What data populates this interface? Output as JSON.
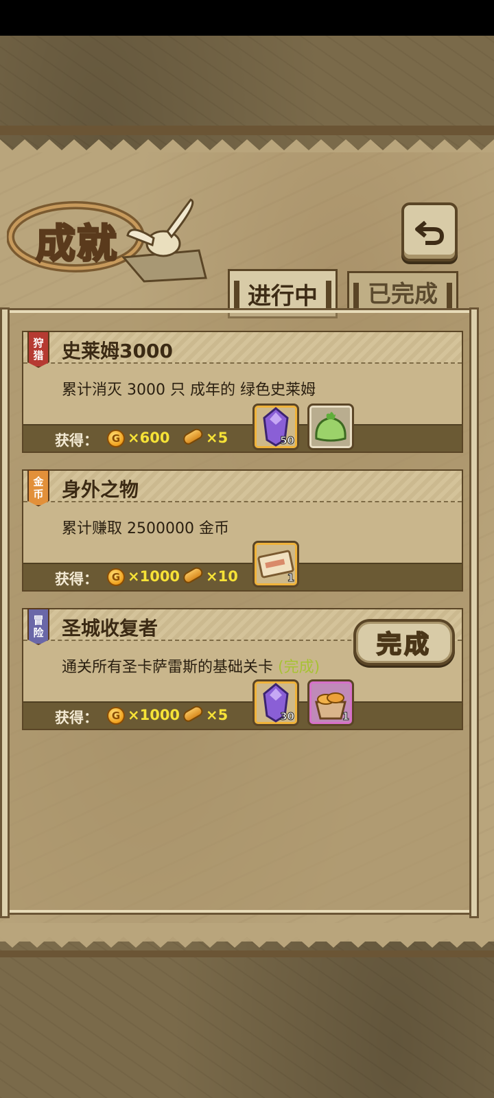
{
  "header": {
    "title": "成就",
    "back_icon": "return-arrow-icon"
  },
  "tabs": [
    {
      "label": "进行中",
      "active": true
    },
    {
      "label": "已完成",
      "active": false
    }
  ],
  "reward_label": "获得：",
  "achievements": [
    {
      "category": "狩猎",
      "badge_color": "#b63a32",
      "title": "史莱姆3000",
      "description": "累计消灭 3000 只 成年的 绿色史莱姆",
      "done_tag": "",
      "gold": "×600",
      "bread": "×5",
      "items": [
        {
          "icon": "purple-crystal-icon",
          "count": "50"
        },
        {
          "icon": "green-slime-icon",
          "count": ""
        }
      ]
    },
    {
      "category": "金币",
      "badge_color": "#e2903a",
      "title": "身外之物",
      "description": "累计赚取 2500000 金币",
      "done_tag": "",
      "gold": "×1000",
      "bread": "×10",
      "items": [
        {
          "icon": "ticket-icon",
          "count": "1"
        }
      ]
    },
    {
      "category": "冒险",
      "badge_color": "#6a67a8",
      "title": "圣城收复者",
      "description": "通关所有圣卡萨雷斯的基础关卡",
      "done_tag": "(完成)",
      "gold": "×1000",
      "bread": "×5",
      "items": [
        {
          "icon": "purple-crystal-icon",
          "count": "30"
        },
        {
          "icon": "bread-basket-icon",
          "count": "1"
        }
      ],
      "button_label": "完成"
    }
  ],
  "colors": {
    "reward_text": "#f6e237",
    "done_tag": "#a7c234"
  }
}
